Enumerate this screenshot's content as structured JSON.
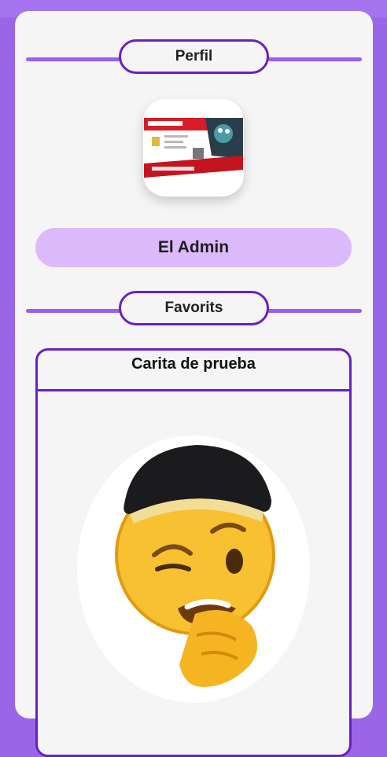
{
  "profile_section": {
    "title": "Perfil"
  },
  "profile": {
    "image_alt": "licencia-card",
    "name": "El Admin"
  },
  "favorites_section": {
    "title": "Favorits"
  },
  "favorites": [
    {
      "title": "Carita de prueba",
      "image": "thinking-face-emoji-with-cap"
    }
  ],
  "colors": {
    "background": "#9a66e8",
    "accent": "#6a1fc7",
    "name_pill": "#dcb9fb"
  }
}
